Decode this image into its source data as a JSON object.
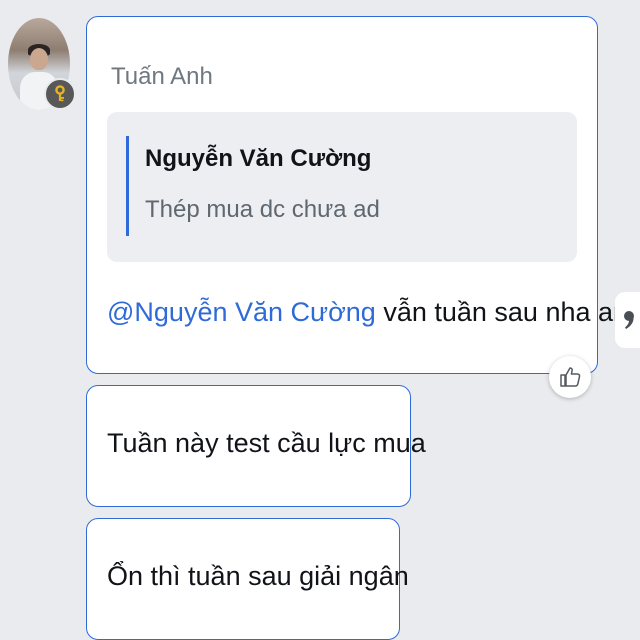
{
  "messages": [
    {
      "sender": "Tuấn Anh",
      "reply_quote": {
        "author": "Nguyễn Văn Cường",
        "text": "Thép mua dc chưa ad"
      },
      "mention": "@Nguyễn Văn Cường",
      "text": " vẫn tuần sau nha anh"
    },
    {
      "text": "Tuần này test cầu lực mua"
    },
    {
      "text": "Ổn thì tuần sau giải ngân"
    }
  ],
  "icons": {
    "avatar_badge": "key-icon",
    "reaction": "thumbs-up-icon",
    "side_action": "quote-icon"
  },
  "colors": {
    "accent": "#2f6bd8",
    "background": "#e9ebee",
    "key_badge": "#585858",
    "key": "#e6b325"
  }
}
